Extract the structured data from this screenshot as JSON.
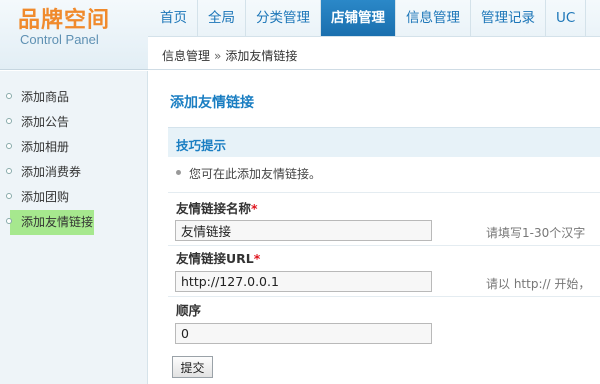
{
  "logo": {
    "cn": "品牌空间",
    "en": "Control Panel"
  },
  "nav": {
    "items": [
      {
        "label": "首页"
      },
      {
        "label": "全局"
      },
      {
        "label": "分类管理"
      },
      {
        "label": "店铺管理",
        "active": true
      },
      {
        "label": "信息管理"
      },
      {
        "label": "管理记录"
      },
      {
        "label": "UC"
      }
    ]
  },
  "breadcrumb": {
    "parent": "信息管理",
    "separator": "»",
    "current": "添加友情链接"
  },
  "sidebar": {
    "items": [
      {
        "label": "添加商品"
      },
      {
        "label": "添加公告"
      },
      {
        "label": "添加相册"
      },
      {
        "label": "添加消费券"
      },
      {
        "label": "添加团购"
      },
      {
        "label": "添加友情链接",
        "active": true
      }
    ]
  },
  "main": {
    "title": "添加友情链接",
    "tips_title": "技巧提示",
    "tips_text": "您可在此添加友情链接。",
    "fields": {
      "name": {
        "label": "友情链接名称",
        "required": "*",
        "value": "友情链接",
        "hint": "请填写1-30个汉字"
      },
      "url": {
        "label": "友情链接URL",
        "required": "*",
        "value": "http://127.0.0.1",
        "hint": "请以 http:// 开始，"
      },
      "order": {
        "label": "顺序",
        "value": "0"
      }
    },
    "submit_label": "提交"
  },
  "colors": {
    "accent": "#1a7ec2",
    "nav_active": "#1f78b8",
    "logo_orange": "#f08a2c",
    "highlight": "#a6e88e",
    "required": "#e0141e"
  }
}
